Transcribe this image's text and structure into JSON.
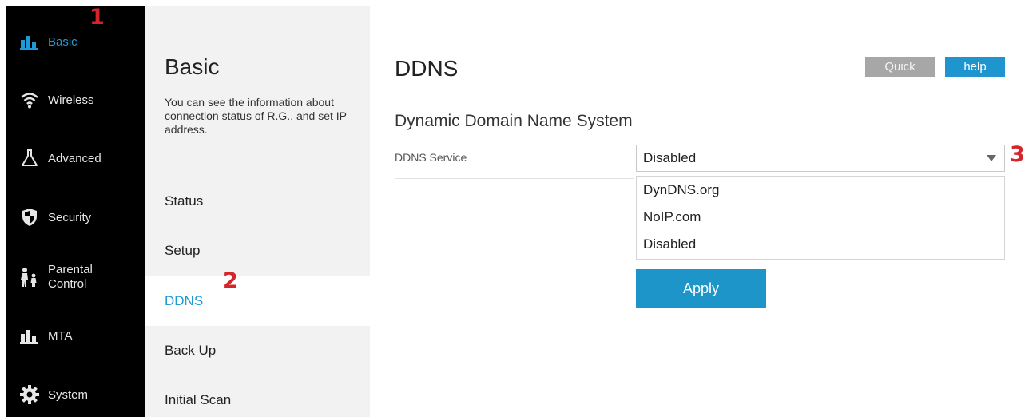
{
  "nav": {
    "items": [
      {
        "label": "Basic",
        "icon": "bar-chart-icon",
        "active": true
      },
      {
        "label": "Wireless",
        "icon": "wifi-icon"
      },
      {
        "label": "Advanced",
        "icon": "flask-icon"
      },
      {
        "label": "Security",
        "icon": "shield-icon"
      },
      {
        "label": "Parental",
        "label2": "Control",
        "icon": "family-icon"
      },
      {
        "label": "MTA",
        "icon": "bar-chart-icon"
      },
      {
        "label": "System",
        "icon": "gear-icon"
      }
    ]
  },
  "sub": {
    "title": "Basic",
    "description": "You can see the information about connection status of R.G., and set IP address.",
    "items": [
      {
        "label": "Status"
      },
      {
        "label": "Setup"
      },
      {
        "label": "DDNS",
        "active": true
      },
      {
        "label": "Back Up"
      },
      {
        "label": "Initial Scan"
      }
    ]
  },
  "main": {
    "title": "DDNS",
    "quick_label": "Quick",
    "help_label": "help",
    "section_title": "Dynamic Domain Name System",
    "ddns_label": "DDNS Service",
    "ddns_selected": "Disabled",
    "ddns_options": [
      "DynDNS.org",
      "NoIP.com",
      "Disabled"
    ],
    "apply_label": "Apply"
  },
  "markers": [
    "1",
    "2",
    "3"
  ],
  "colors": {
    "accent": "#1f9ad6",
    "nav_bg": "#000000",
    "marker": "#d4252a"
  }
}
